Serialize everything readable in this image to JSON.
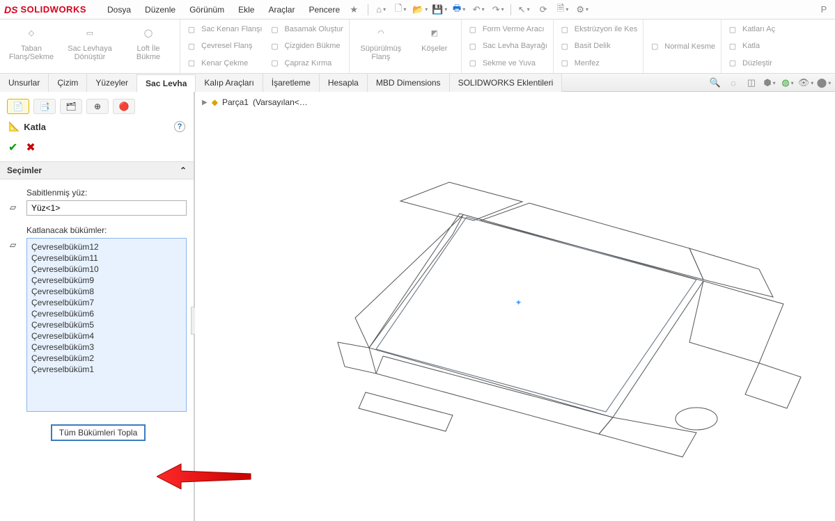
{
  "app": {
    "brand_prefix": "DS",
    "brand": "SOLIDWORKS"
  },
  "menu": {
    "file": "Dosya",
    "edit": "Düzenle",
    "view": "Görünüm",
    "insert": "Ekle",
    "tools": "Araçlar",
    "window": "Pencere"
  },
  "ribbon": {
    "g1": {
      "base_tab": "Taban\nFlanş/Sekme",
      "convert": "Sac Levhaya\nDönüştür",
      "loft_bend": "Loft İle\nBükme"
    },
    "g2": {
      "edge_flange": "Sac Kenarı Flanşı",
      "miter_flange": "Çevresel Flanş",
      "hem": "Kenar Çekme"
    },
    "g3": {
      "jog": "Basamak Oluştur",
      "sketched_bend": "Çizgiden Bükme",
      "cross_break": "Çapraz Kırma"
    },
    "g4": {
      "swept_flange": "Süpürülmüş\nFlanş",
      "corners": "Köşeler"
    },
    "g5": {
      "forming_tool": "Form Verme Aracı",
      "sheet_metal_gusset": "Sac Levha Bayrağı",
      "tab_and_slot": "Sekme ve Yuva"
    },
    "g6": {
      "extruded_cut": "Ekstrüzyon ile Kes",
      "simple_hole": "Basit Delik",
      "vent": "Menfez"
    },
    "g7": {
      "normal_cut": "Normal Kesme"
    },
    "g8": {
      "unfold": "Katları Aç",
      "fold": "Katla",
      "flatten": "Düzleştir"
    }
  },
  "tabs": {
    "features": "Unsurlar",
    "sketch": "Çizim",
    "surfaces": "Yüzeyler",
    "sheet_metal": "Sac Levha",
    "mold_tools": "Kalıp Araçları",
    "markup": "İşaretleme",
    "evaluate": "Hesapla",
    "mbd": "MBD Dimensions",
    "addins": "SOLIDWORKS Eklentileri"
  },
  "pm": {
    "title": "Katla",
    "section": "Seçimler",
    "fixed_face_label": "Sabitlenmiş yüz:",
    "fixed_face_value": "Yüz<1>",
    "bends_label": "Katlanacak bükümler:",
    "bends": [
      "Çevreselbüküm12",
      "Çevreselbüküm11",
      "Çevreselbüküm10",
      "Çevreselbüküm9",
      "Çevreselbüküm8",
      "Çevreselbüküm7",
      "Çevreselbüküm6",
      "Çevreselbüküm5",
      "Çevreselbüküm4",
      "Çevreselbüküm3",
      "Çevreselbüküm2",
      "Çevreselbüküm1"
    ],
    "collect_all": "Tüm Bükümleri Topla"
  },
  "breadcrumb": {
    "part": "Parça1",
    "config": "(Varsayılan<…"
  }
}
